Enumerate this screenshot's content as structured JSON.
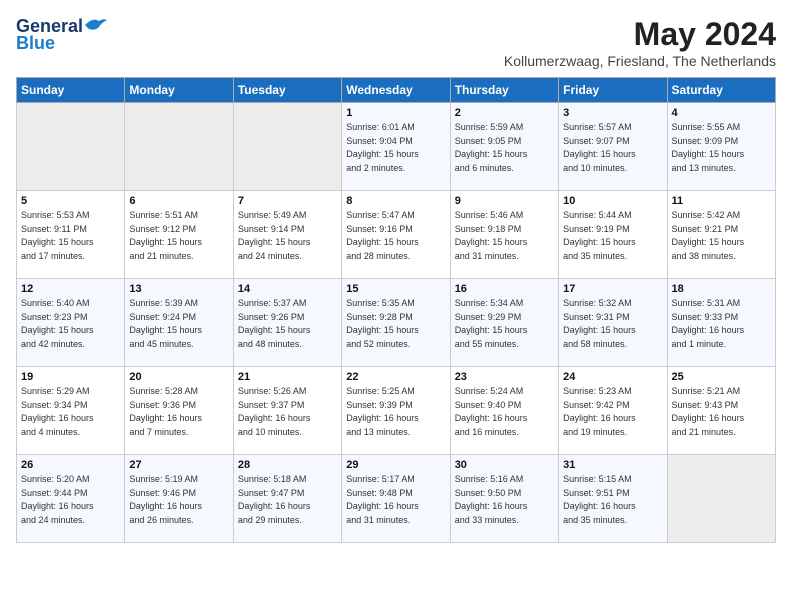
{
  "logo": {
    "line1": "General",
    "line2": "Blue"
  },
  "title": "May 2024",
  "subtitle": "Kollumerzwaag, Friesland, The Netherlands",
  "days_of_week": [
    "Sunday",
    "Monday",
    "Tuesday",
    "Wednesday",
    "Thursday",
    "Friday",
    "Saturday"
  ],
  "weeks": [
    [
      {
        "num": "",
        "info": ""
      },
      {
        "num": "",
        "info": ""
      },
      {
        "num": "",
        "info": ""
      },
      {
        "num": "1",
        "info": "Sunrise: 6:01 AM\nSunset: 9:04 PM\nDaylight: 15 hours\nand 2 minutes."
      },
      {
        "num": "2",
        "info": "Sunrise: 5:59 AM\nSunset: 9:05 PM\nDaylight: 15 hours\nand 6 minutes."
      },
      {
        "num": "3",
        "info": "Sunrise: 5:57 AM\nSunset: 9:07 PM\nDaylight: 15 hours\nand 10 minutes."
      },
      {
        "num": "4",
        "info": "Sunrise: 5:55 AM\nSunset: 9:09 PM\nDaylight: 15 hours\nand 13 minutes."
      }
    ],
    [
      {
        "num": "5",
        "info": "Sunrise: 5:53 AM\nSunset: 9:11 PM\nDaylight: 15 hours\nand 17 minutes."
      },
      {
        "num": "6",
        "info": "Sunrise: 5:51 AM\nSunset: 9:12 PM\nDaylight: 15 hours\nand 21 minutes."
      },
      {
        "num": "7",
        "info": "Sunrise: 5:49 AM\nSunset: 9:14 PM\nDaylight: 15 hours\nand 24 minutes."
      },
      {
        "num": "8",
        "info": "Sunrise: 5:47 AM\nSunset: 9:16 PM\nDaylight: 15 hours\nand 28 minutes."
      },
      {
        "num": "9",
        "info": "Sunrise: 5:46 AM\nSunset: 9:18 PM\nDaylight: 15 hours\nand 31 minutes."
      },
      {
        "num": "10",
        "info": "Sunrise: 5:44 AM\nSunset: 9:19 PM\nDaylight: 15 hours\nand 35 minutes."
      },
      {
        "num": "11",
        "info": "Sunrise: 5:42 AM\nSunset: 9:21 PM\nDaylight: 15 hours\nand 38 minutes."
      }
    ],
    [
      {
        "num": "12",
        "info": "Sunrise: 5:40 AM\nSunset: 9:23 PM\nDaylight: 15 hours\nand 42 minutes."
      },
      {
        "num": "13",
        "info": "Sunrise: 5:39 AM\nSunset: 9:24 PM\nDaylight: 15 hours\nand 45 minutes."
      },
      {
        "num": "14",
        "info": "Sunrise: 5:37 AM\nSunset: 9:26 PM\nDaylight: 15 hours\nand 48 minutes."
      },
      {
        "num": "15",
        "info": "Sunrise: 5:35 AM\nSunset: 9:28 PM\nDaylight: 15 hours\nand 52 minutes."
      },
      {
        "num": "16",
        "info": "Sunrise: 5:34 AM\nSunset: 9:29 PM\nDaylight: 15 hours\nand 55 minutes."
      },
      {
        "num": "17",
        "info": "Sunrise: 5:32 AM\nSunset: 9:31 PM\nDaylight: 15 hours\nand 58 minutes."
      },
      {
        "num": "18",
        "info": "Sunrise: 5:31 AM\nSunset: 9:33 PM\nDaylight: 16 hours\nand 1 minute."
      }
    ],
    [
      {
        "num": "19",
        "info": "Sunrise: 5:29 AM\nSunset: 9:34 PM\nDaylight: 16 hours\nand 4 minutes."
      },
      {
        "num": "20",
        "info": "Sunrise: 5:28 AM\nSunset: 9:36 PM\nDaylight: 16 hours\nand 7 minutes."
      },
      {
        "num": "21",
        "info": "Sunrise: 5:26 AM\nSunset: 9:37 PM\nDaylight: 16 hours\nand 10 minutes."
      },
      {
        "num": "22",
        "info": "Sunrise: 5:25 AM\nSunset: 9:39 PM\nDaylight: 16 hours\nand 13 minutes."
      },
      {
        "num": "23",
        "info": "Sunrise: 5:24 AM\nSunset: 9:40 PM\nDaylight: 16 hours\nand 16 minutes."
      },
      {
        "num": "24",
        "info": "Sunrise: 5:23 AM\nSunset: 9:42 PM\nDaylight: 16 hours\nand 19 minutes."
      },
      {
        "num": "25",
        "info": "Sunrise: 5:21 AM\nSunset: 9:43 PM\nDaylight: 16 hours\nand 21 minutes."
      }
    ],
    [
      {
        "num": "26",
        "info": "Sunrise: 5:20 AM\nSunset: 9:44 PM\nDaylight: 16 hours\nand 24 minutes."
      },
      {
        "num": "27",
        "info": "Sunrise: 5:19 AM\nSunset: 9:46 PM\nDaylight: 16 hours\nand 26 minutes."
      },
      {
        "num": "28",
        "info": "Sunrise: 5:18 AM\nSunset: 9:47 PM\nDaylight: 16 hours\nand 29 minutes."
      },
      {
        "num": "29",
        "info": "Sunrise: 5:17 AM\nSunset: 9:48 PM\nDaylight: 16 hours\nand 31 minutes."
      },
      {
        "num": "30",
        "info": "Sunrise: 5:16 AM\nSunset: 9:50 PM\nDaylight: 16 hours\nand 33 minutes."
      },
      {
        "num": "31",
        "info": "Sunrise: 5:15 AM\nSunset: 9:51 PM\nDaylight: 16 hours\nand 35 minutes."
      },
      {
        "num": "",
        "info": ""
      }
    ]
  ]
}
